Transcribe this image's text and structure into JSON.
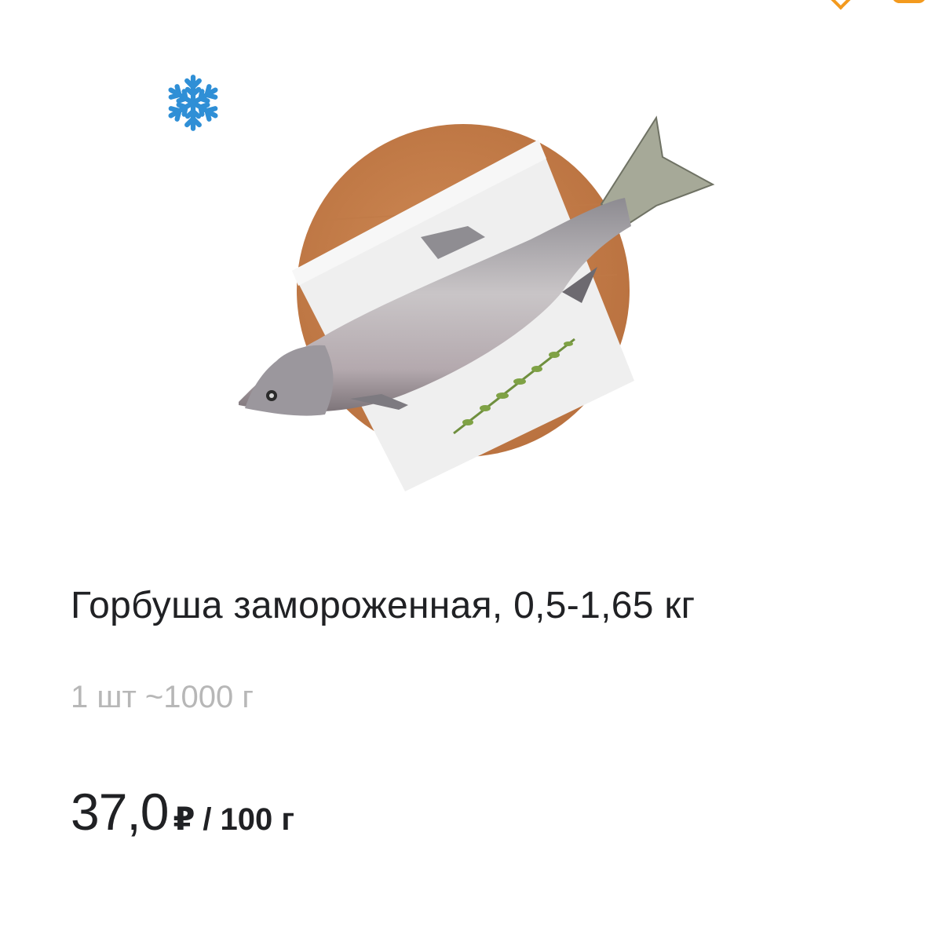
{
  "header": {
    "favorite_icon": "heart-icon",
    "cart_icon": "cart-icon",
    "accent_color": "#f39a1e"
  },
  "product": {
    "badge_icon": "snowflake-icon",
    "badge_color": "#2f8fd6",
    "title": "Горбуша замороженная, 0,5-1,65 кг",
    "weight": "1 шт ~1000 г",
    "price_value": "37,0",
    "price_currency": "₽",
    "price_unit": "/ 100 г"
  }
}
